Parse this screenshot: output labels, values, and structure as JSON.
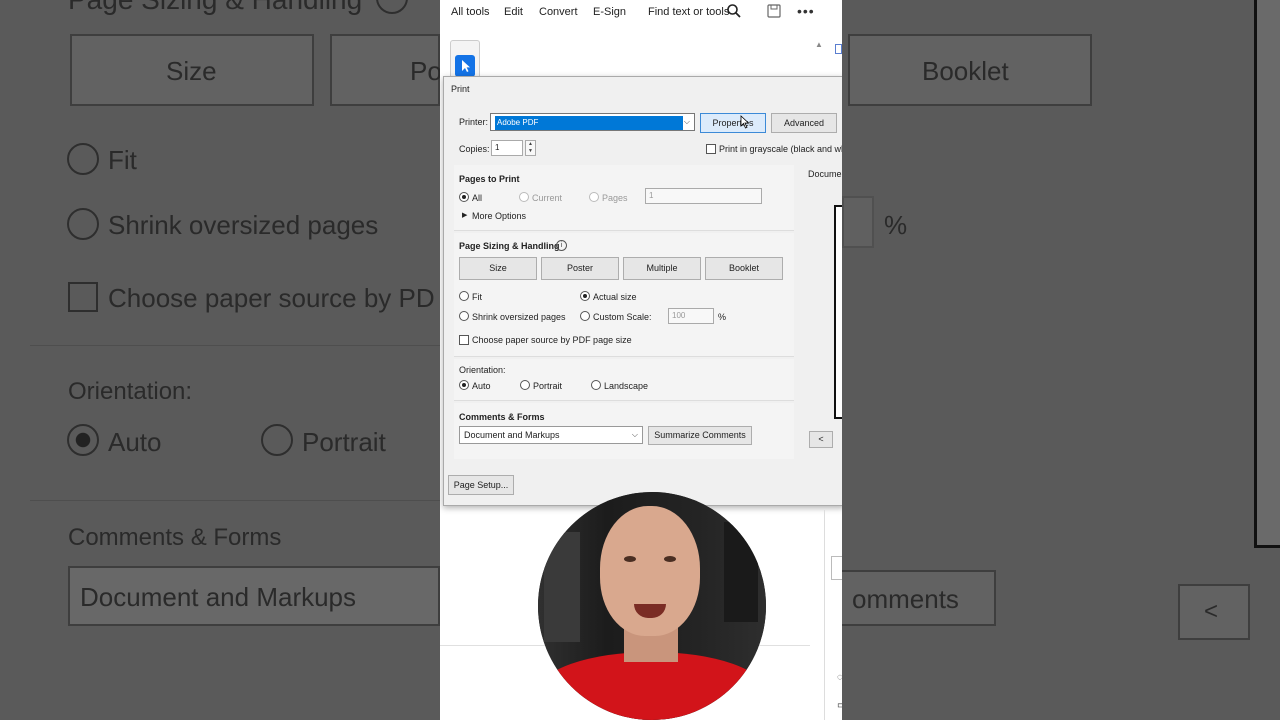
{
  "toolbar": {
    "all_tools": "All tools",
    "edit": "Edit",
    "convert": "Convert",
    "esign": "E-Sign",
    "find": "Find text or tools"
  },
  "bg": {
    "heading": "Page Sizing & Handling",
    "size": "Size",
    "po": "Po",
    "booklet": "Booklet",
    "fit": "Fit",
    "shrink": "Shrink oversized pages",
    "choose": "Choose paper source by PD",
    "pct": "%",
    "orientation": "Orientation:",
    "auto": "Auto",
    "portrait": "Portrait",
    "comments_forms": "Comments & Forms",
    "doc_markups": "Document and Markups",
    "comments": "omments",
    "lt": "<"
  },
  "dialog": {
    "title": "Print",
    "printer_label": "Printer:",
    "printer_value": "Adobe PDF",
    "properties": "Properties",
    "advanced": "Advanced",
    "copies_label": "Copies:",
    "copies_value": "1",
    "grayscale": "Print in grayscale (black and wh",
    "pages_to_print": "Pages to Print",
    "all": "All",
    "current": "Current",
    "pages": "Pages",
    "pages_value": "1",
    "more_options": "More Options",
    "sizing_heading": "Page Sizing & Handling",
    "size": "Size",
    "poster": "Poster",
    "multiple": "Multiple",
    "booklet": "Booklet",
    "fit": "Fit",
    "actual_size": "Actual size",
    "shrink": "Shrink oversized pages",
    "custom_scale": "Custom Scale:",
    "scale_value": "100",
    "pct": "%",
    "choose_paper": "Choose paper source by PDF page size",
    "orientation": "Orientation:",
    "auto": "Auto",
    "portrait": "Portrait",
    "landscape": "Landscape",
    "comments_forms": "Comments & Forms",
    "comments_select": "Document and Markups",
    "summarize": "Summarize Comments",
    "page_setup": "Page Setup...",
    "document_label": "Documen",
    "nav_prev": "<"
  }
}
